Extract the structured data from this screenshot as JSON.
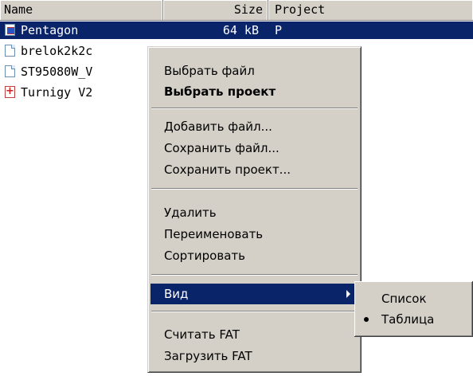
{
  "list": {
    "columns": {
      "name": "Name",
      "size": "Size",
      "project": "Project"
    },
    "rows": [
      {
        "name": "Pentagon",
        "icon": "pentagon-file-icon",
        "size": "64 kB",
        "project": "P"
      },
      {
        "name": "brelok2k2c",
        "icon": "document-icon"
      },
      {
        "name": "ST95080W_V",
        "icon": "document-icon"
      },
      {
        "name": "Turnigy V2",
        "icon": "red-plus-document-icon"
      }
    ]
  },
  "context_menu": {
    "items": [
      "Выбрать файл",
      "Выбрать проект",
      "Добавить файл...",
      "Сохранить файл...",
      "Сохранить проект...",
      "Удалить",
      "Переименовать",
      "Сортировать",
      "Вид",
      "Считать FAT",
      "Загрузить FAT"
    ]
  },
  "view_submenu": {
    "items": [
      "Список",
      "Таблица"
    ],
    "selected": "Таблица"
  }
}
